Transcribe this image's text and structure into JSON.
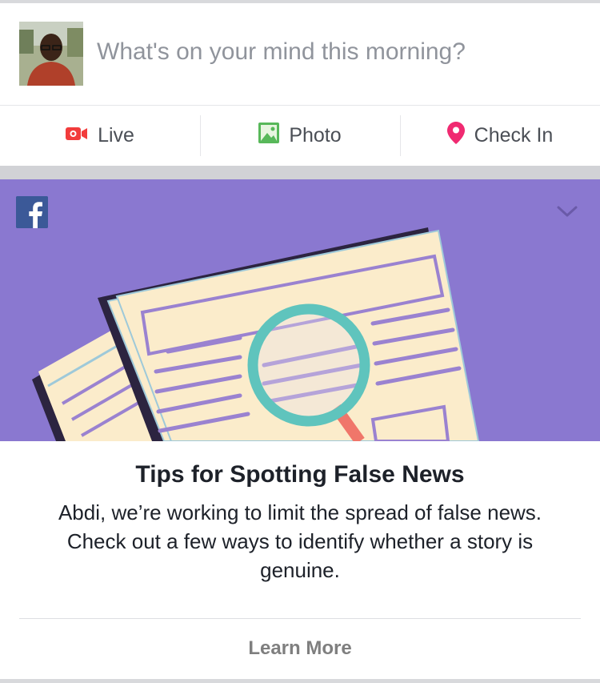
{
  "composer": {
    "prompt": "What's on your mind this morning?",
    "avatar_icon": "user-avatar"
  },
  "actions": [
    {
      "label": "Live",
      "icon": "live-video-icon",
      "color": "#f23c3c"
    },
    {
      "label": "Photo",
      "icon": "photo-icon",
      "color": "#58b85a"
    },
    {
      "label": "Check In",
      "icon": "location-pin-icon",
      "color": "#f02a71"
    }
  ],
  "card": {
    "logo_icon": "facebook-logo",
    "menu_icon": "chevron-down-icon",
    "hero_background": "#8a78d0",
    "title": "Tips for Spotting False News",
    "body": "Abdi, we’re working to limit the spread of false news. Check out a few ways to identify whether a story is genuine.",
    "cta": "Learn More"
  },
  "colors": {
    "brand_blue": "#3b5998",
    "text_primary": "#1d2129",
    "text_secondary": "#90949c",
    "section_gray": "#d1d2d6"
  }
}
